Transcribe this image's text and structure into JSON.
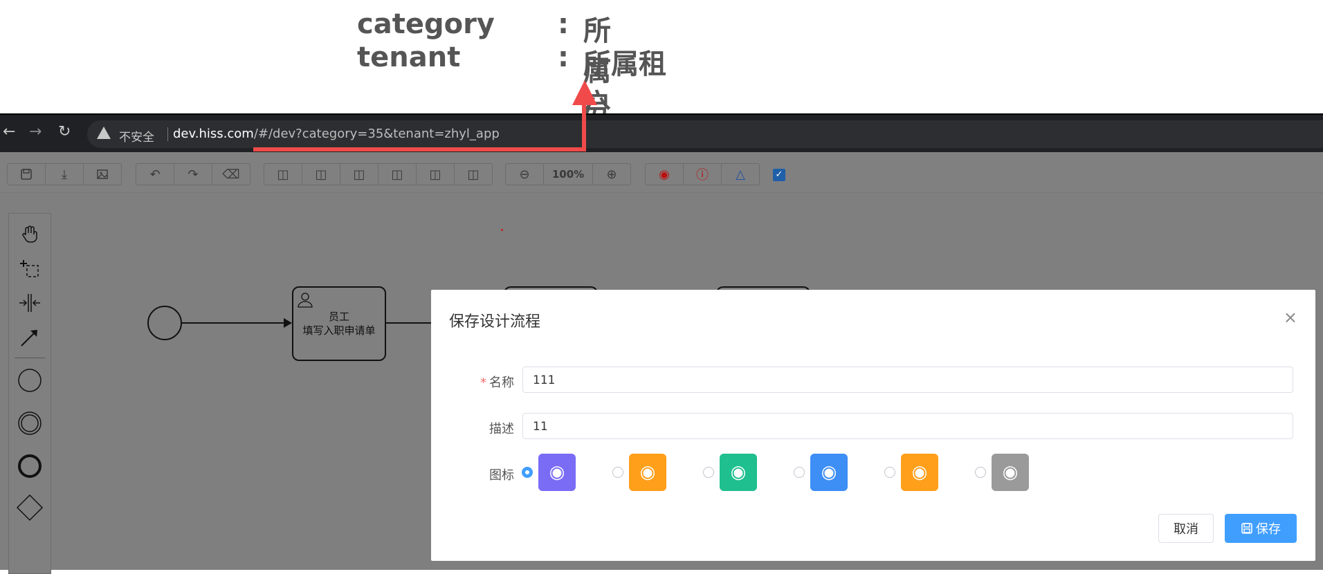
{
  "annotation": {
    "rows": [
      {
        "key": "category",
        "colon": ":",
        "value": "所属分类"
      },
      {
        "key": "tenant",
        "colon": ":",
        "value": "所属租户AppID"
      }
    ]
  },
  "browser": {
    "security_label": "不安全",
    "url_host": "dev.hiss.com",
    "url_rest": "/#/dev?category=35&tenant=zhyl_app"
  },
  "toolbar": {
    "zoom": "100%",
    "icons": [
      "save-icon",
      "download-icon",
      "image-icon",
      "undo-icon",
      "redo-icon",
      "eraser-icon",
      "align-left-icon",
      "align-center-icon",
      "align-right-icon",
      "align-top-icon",
      "align-middle-icon",
      "align-bottom-icon",
      "zoom-out-icon",
      "zoom-in-icon",
      "sim-icon",
      "validate-icon",
      "stamp-icon",
      "checkbox-icon"
    ]
  },
  "canvas": {
    "task": {
      "line1": "员工",
      "line2": "填写入职申请单"
    }
  },
  "modal": {
    "title": "保存设计流程",
    "close": "×",
    "fields": {
      "name": {
        "label": "名称",
        "required_mark": "*",
        "value": "111"
      },
      "description": {
        "label": "描述",
        "value": "11"
      },
      "icon": {
        "label": "图标",
        "selected_index": 0
      }
    },
    "icon_options": [
      {
        "name": "calendar-add-icon",
        "color": "#7b6cf6"
      },
      {
        "name": "document-sign-icon",
        "color": "#ff9f1a"
      },
      {
        "name": "person-leave-icon",
        "color": "#1fbf8f"
      },
      {
        "name": "person-run-icon",
        "color": "#3d8ef5"
      },
      {
        "name": "desk-lamp-icon",
        "color": "#ff9f1a"
      },
      {
        "name": "person-leave-gray-icon",
        "color": "#9a9a9a"
      }
    ],
    "cancel_label": "取消",
    "save_label": "保存"
  },
  "colors": {
    "accent": "#409eff",
    "arrow": "#f04a4a"
  }
}
